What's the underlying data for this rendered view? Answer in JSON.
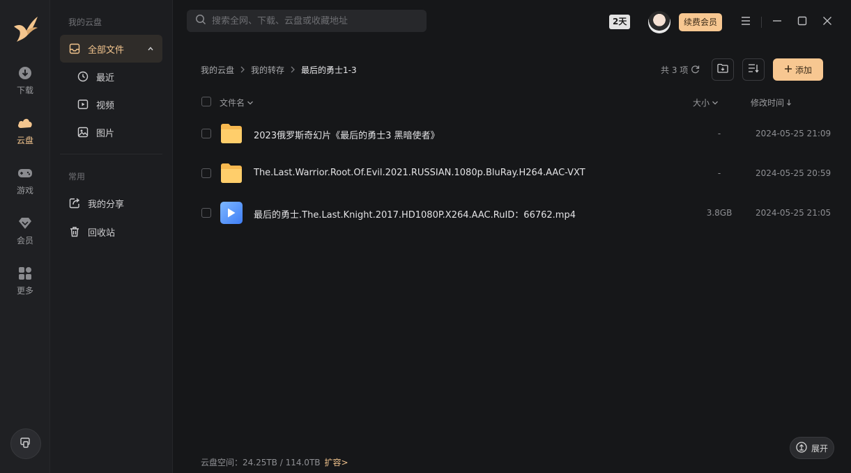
{
  "rail": {
    "items": [
      {
        "label": "下载"
      },
      {
        "label": "云盘"
      },
      {
        "label": "游戏"
      },
      {
        "label": "会员"
      },
      {
        "label": "更多"
      }
    ],
    "active": "云盘"
  },
  "sidebar": {
    "section_my": "我的云盘",
    "all_files": "全部文件",
    "recent": "最近",
    "video": "视频",
    "image": "图片",
    "section_common": "常用",
    "my_share": "我的分享",
    "recycle": "回收站"
  },
  "header": {
    "search_placeholder": "搜索全网、下载、云盘或收藏地址",
    "days_badge": "2天",
    "renew_label": "续费会员"
  },
  "breadcrumb": {
    "items": [
      "我的云盘",
      "我的转存",
      "最后的勇士1-3"
    ]
  },
  "toolbar": {
    "count_text": "共 3 项",
    "add_label": "添加"
  },
  "table": {
    "columns": {
      "name": "文件名",
      "size": "大小",
      "time": "修改时间"
    },
    "rows": [
      {
        "type": "folder",
        "name": "2023俄罗斯奇幻片《最后的勇士3 黑暗使者》",
        "size": "-",
        "time": "2024-05-25 21:09"
      },
      {
        "type": "folder",
        "name": "The.Last.Warrior.Root.Of.Evil.2021.RUSSIAN.1080p.BluRay.H264.AAC-VXT",
        "size": "-",
        "time": "2024-05-25 20:59"
      },
      {
        "type": "video",
        "name": "最后的勇士.The.Last.Knight.2017.HD1080P.X264.AAC.RuID：66762.mp4",
        "size": "3.8GB",
        "time": "2024-05-25 21:05"
      }
    ]
  },
  "footer": {
    "storage_text": "云盘空间：24.25TB / 114.0TB",
    "expand_capacity": "扩容>",
    "expand_button": "展开"
  },
  "colors": {
    "accent": "#f7c791",
    "accent_text": "#f3c58e",
    "background": "#161719"
  }
}
